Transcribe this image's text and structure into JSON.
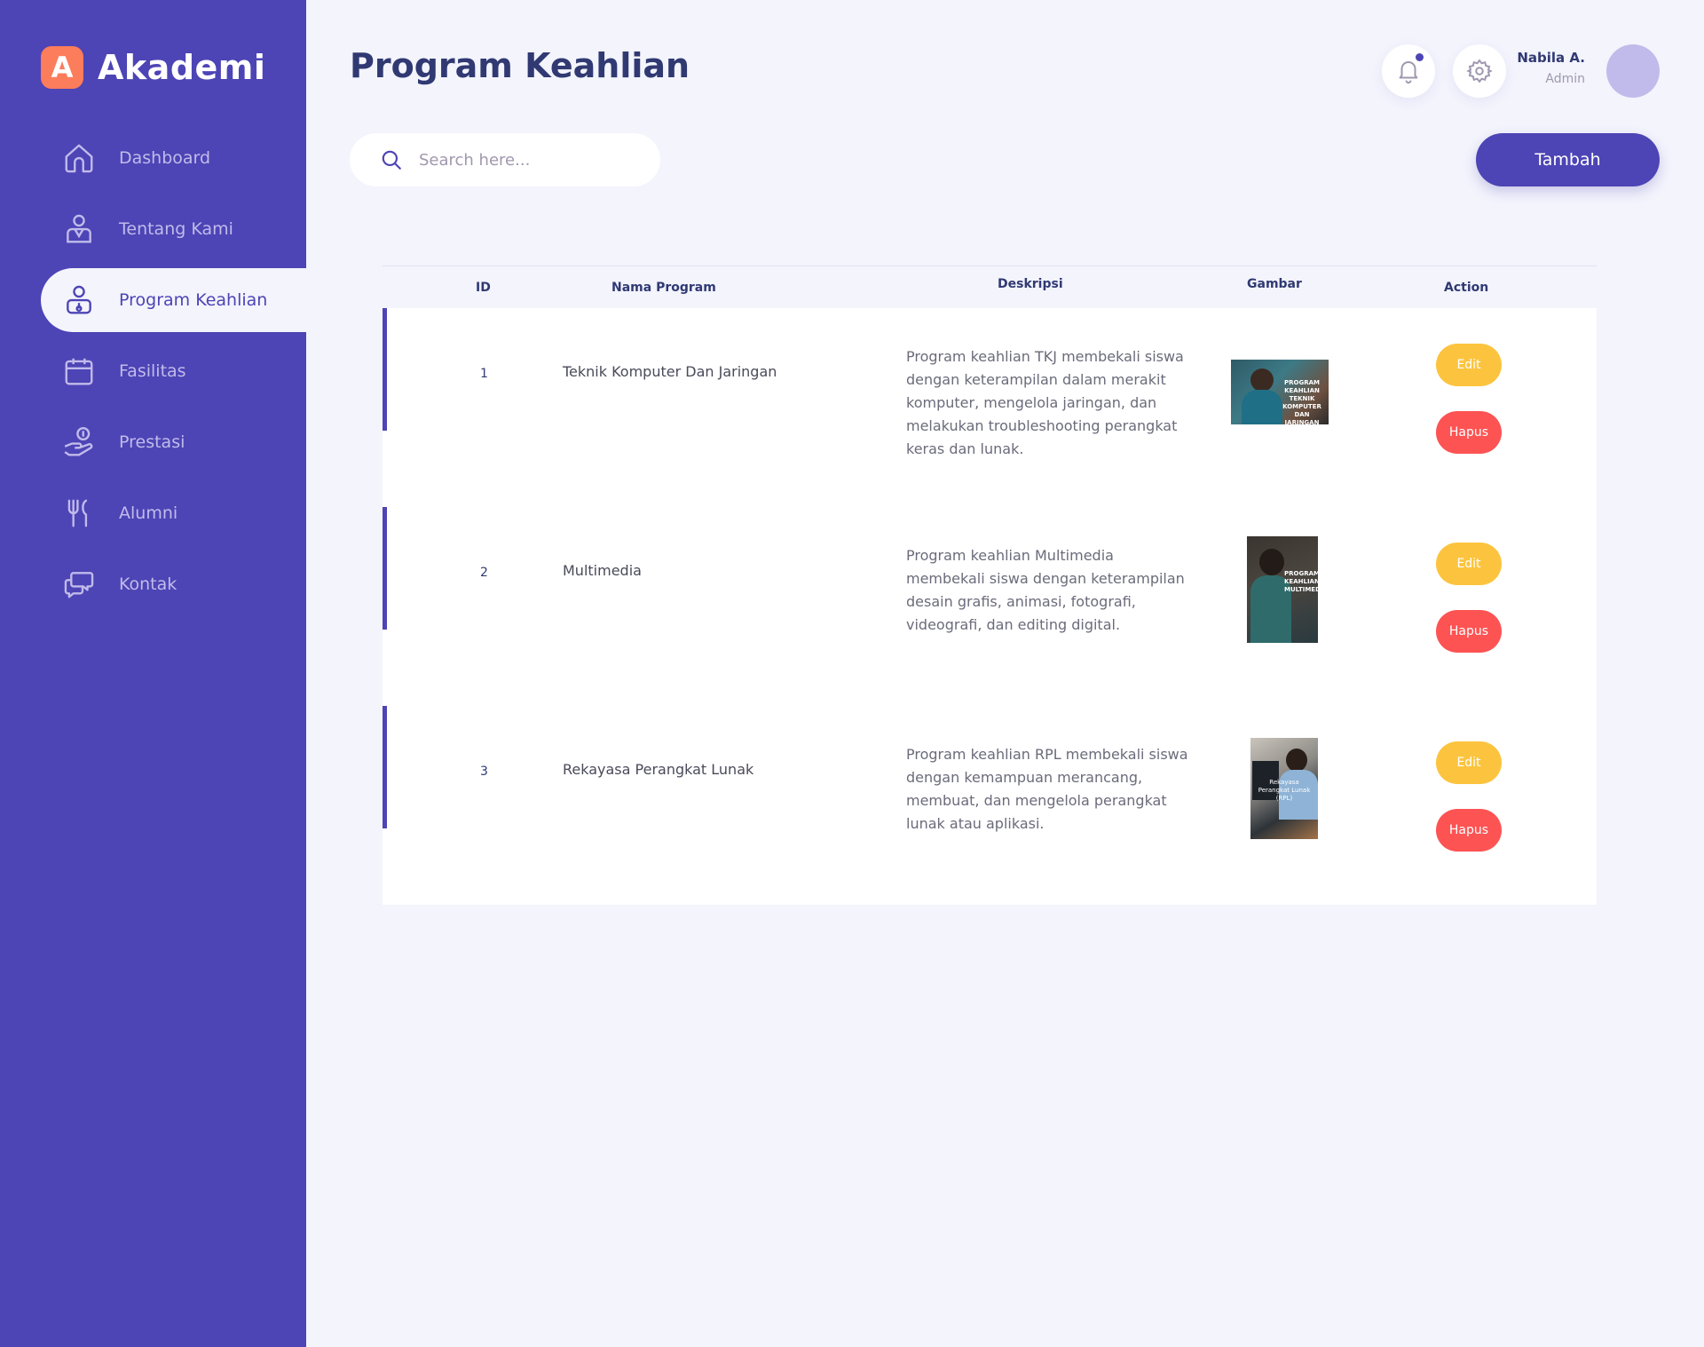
{
  "app": {
    "logo_letter": "A",
    "name": "Akademi"
  },
  "sidebar": {
    "items": [
      {
        "label": "Dashboard",
        "icon": "home-icon",
        "active": false
      },
      {
        "label": "Tentang Kami",
        "icon": "person-icon",
        "active": false
      },
      {
        "label": "Program Keahlian",
        "icon": "person-badge-icon",
        "active": true
      },
      {
        "label": "Fasilitas",
        "icon": "calendar-icon",
        "active": false
      },
      {
        "label": "Prestasi",
        "icon": "hand-coin-icon",
        "active": false
      },
      {
        "label": "Alumni",
        "icon": "fork-knife-icon",
        "active": false
      },
      {
        "label": "Kontak",
        "icon": "chat-bubbles-icon",
        "active": false
      }
    ]
  },
  "header": {
    "title": "Program Keahlian",
    "user_name": "Nabila A.",
    "user_role": "Admin"
  },
  "search": {
    "placeholder": "Search here..."
  },
  "toolbar": {
    "add_label": "Tambah"
  },
  "table": {
    "columns": {
      "id": "ID",
      "name": "Nama Program",
      "desc": "Deskripsi",
      "image": "Gambar",
      "action": "Action"
    },
    "rows": [
      {
        "id": "1",
        "name": "Teknik Komputer Dan Jaringan",
        "description": "Program keahlian TKJ membekali siswa dengan keterampilan dalam merakit komputer, mengelola jaringan, dan melakukan troubleshooting perangkat keras dan lunak.",
        "image_caption": "PROGRAM KEAHLIAN TEKNIK KOMPUTER DAN JARINGAN",
        "edit_label": "Edit",
        "delete_label": "Hapus"
      },
      {
        "id": "2",
        "name": "Multimedia",
        "description": "Program keahlian Multimedia membekali siswa dengan keterampilan desain grafis, animasi, fotografi, videografi, dan editing digital.",
        "image_caption": "PROGRAM KEAHLIAN MULTIMEDIA",
        "edit_label": "Edit",
        "delete_label": "Hapus"
      },
      {
        "id": "3",
        "name": "Rekayasa Perangkat Lunak",
        "description": "Program keahlian RPL membekali siswa dengan kemampuan merancang, membuat, dan mengelola perangkat lunak atau aplikasi.",
        "image_caption": "Rekayasa Perangkat Lunak (RPL)",
        "edit_label": "Edit",
        "delete_label": "Hapus"
      }
    ]
  },
  "colors": {
    "primary": "#4d44b5",
    "background": "#f3f4fc",
    "accent_orange": "#fb7d5b",
    "edit_yellow": "#fcc43e",
    "delete_red": "#fd5353",
    "text_dark": "#303972"
  }
}
